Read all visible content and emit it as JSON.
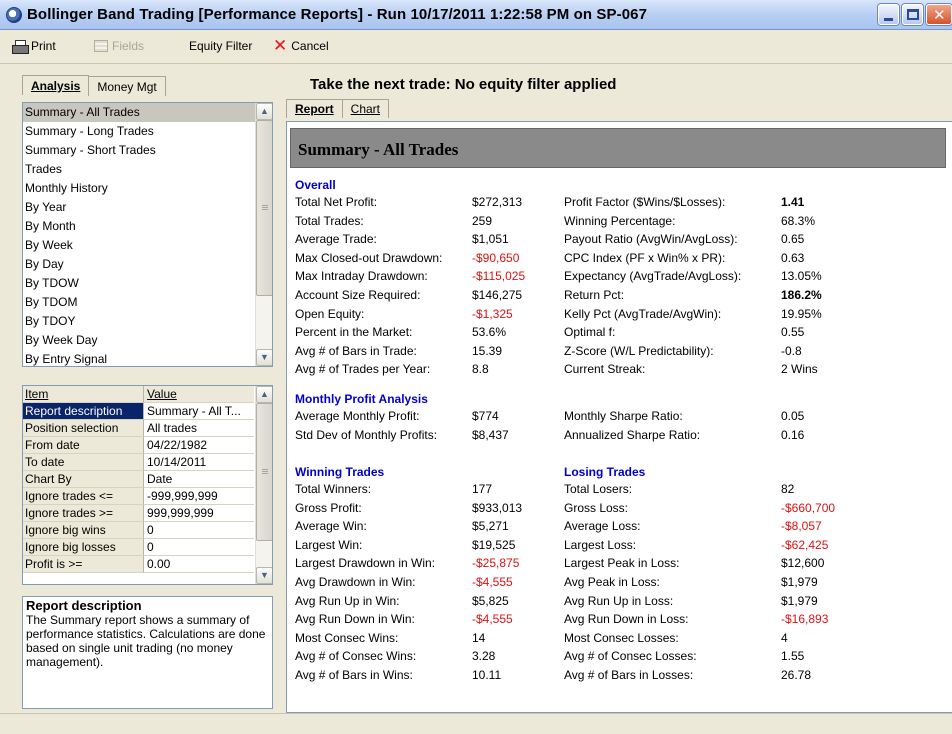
{
  "window": {
    "title": "Bollinger Band Trading  [Performance Reports]  -  Run 10/17/2011 1:22:58 PM on SP-067"
  },
  "toolbar": {
    "print": "Print",
    "fields": "Fields",
    "equity_filter": "Equity Filter",
    "cancel": "Cancel"
  },
  "left_tabs": [
    "Analysis",
    "Money Mgt"
  ],
  "report_list": [
    "Summary - All Trades",
    "Summary - Long Trades",
    "Summary - Short Trades",
    "Trades",
    "Monthly History",
    "By Year",
    "By Month",
    "By Week",
    "By Day",
    "By TDOW",
    "By TDOM",
    "By TDOY",
    "By Week Day",
    "By Entry Signal"
  ],
  "properties": {
    "header": {
      "item": "Item",
      "value": "Value"
    },
    "rows": [
      {
        "item": "Report description",
        "value": "Summary - All T..."
      },
      {
        "item": "Position selection",
        "value": "All trades"
      },
      {
        "item": "From date",
        "value": "04/22/1982"
      },
      {
        "item": "To date",
        "value": "10/14/2011"
      },
      {
        "item": "Chart By",
        "value": "Date"
      },
      {
        "item": "Ignore trades <=",
        "value": "-999,999,999"
      },
      {
        "item": "Ignore trades >=",
        "value": "999,999,999"
      },
      {
        "item": "Ignore big wins",
        "value": "0"
      },
      {
        "item": "Ignore big losses",
        "value": "0"
      },
      {
        "item": "Profit is >=",
        "value": "0.00"
      }
    ]
  },
  "description": {
    "title": "Report description",
    "text": "The Summary report shows a summary of performance statistics.  Calculations are done based on single unit trading (no money management)."
  },
  "headline": "Take the next trade: No equity filter applied",
  "right_tabs": [
    "Report",
    "Chart"
  ],
  "report": {
    "title": "Summary - All Trades",
    "overall_heading": "Overall",
    "overall_left": [
      {
        "label": "Total Net Profit:",
        "value": "$272,313",
        "style": ""
      },
      {
        "label": "Total Trades:",
        "value": "259",
        "style": ""
      },
      {
        "label": "Average Trade:",
        "value": "$1,051",
        "style": ""
      },
      {
        "label": "Max Closed-out Drawdown:",
        "value": "-$90,650",
        "style": "neg"
      },
      {
        "label": "Max Intraday Drawdown:",
        "value": "-$115,025",
        "style": "neg"
      },
      {
        "label": "Account Size Required:",
        "value": "$146,275",
        "style": ""
      },
      {
        "label": "Open Equity:",
        "value": "-$1,325",
        "style": "neg"
      },
      {
        "label": "Percent in the Market:",
        "value": "53.6%",
        "style": ""
      },
      {
        "label": "Avg # of Bars in Trade:",
        "value": "15.39",
        "style": ""
      },
      {
        "label": "Avg # of Trades per Year:",
        "value": "8.8",
        "style": ""
      }
    ],
    "overall_right": [
      {
        "label": "Profit Factor ($Wins/$Losses):",
        "value": "1.41",
        "style": "bold"
      },
      {
        "label": "Winning Percentage:",
        "value": "68.3%",
        "style": ""
      },
      {
        "label": "Payout Ratio (AvgWin/AvgLoss):",
        "value": "0.65",
        "style": ""
      },
      {
        "label": "CPC Index (PF x Win% x PR):",
        "value": "0.63",
        "style": ""
      },
      {
        "label": "Expectancy (AvgTrade/AvgLoss):",
        "value": "13.05%",
        "style": ""
      },
      {
        "label": "Return Pct:",
        "value": "186.2%",
        "style": "bold"
      },
      {
        "label": "Kelly Pct (AvgTrade/AvgWin):",
        "value": "19.95%",
        "style": ""
      },
      {
        "label": "Optimal f:",
        "value": "0.55",
        "style": ""
      },
      {
        "label": "Z-Score (W/L Predictability):",
        "value": "-0.8",
        "style": ""
      },
      {
        "label": "Current Streak:",
        "value": "2 Wins",
        "style": ""
      }
    ],
    "monthly_heading": "Monthly Profit Analysis",
    "monthly_left": [
      {
        "label": "Average Monthly Profit:",
        "value": "$774",
        "style": ""
      },
      {
        "label": "Std Dev of Monthly Profits:",
        "value": "$8,437",
        "style": ""
      }
    ],
    "monthly_right": [
      {
        "label": "Monthly Sharpe Ratio:",
        "value": "0.05",
        "style": ""
      },
      {
        "label": "Annualized Sharpe Ratio:",
        "value": "0.16",
        "style": ""
      }
    ],
    "winning_heading": "Winning Trades",
    "losing_heading": "Losing Trades",
    "winning": [
      {
        "label": "Total Winners:",
        "value": "177",
        "style": ""
      },
      {
        "label": "Gross Profit:",
        "value": "$933,013",
        "style": ""
      },
      {
        "label": "Average Win:",
        "value": "$5,271",
        "style": ""
      },
      {
        "label": "Largest Win:",
        "value": "$19,525",
        "style": ""
      },
      {
        "label": "Largest Drawdown in Win:",
        "value": "-$25,875",
        "style": "neg"
      },
      {
        "label": "Avg Drawdown in Win:",
        "value": "-$4,555",
        "style": "neg"
      },
      {
        "label": "Avg Run Up in Win:",
        "value": "$5,825",
        "style": ""
      },
      {
        "label": "Avg Run Down in Win:",
        "value": "-$4,555",
        "style": "neg"
      },
      {
        "label": "Most Consec Wins:",
        "value": "14",
        "style": ""
      },
      {
        "label": "Avg # of Consec Wins:",
        "value": "3.28",
        "style": ""
      },
      {
        "label": "Avg # of Bars in Wins:",
        "value": "10.11",
        "style": ""
      }
    ],
    "losing": [
      {
        "label": "Total Losers:",
        "value": "82",
        "style": ""
      },
      {
        "label": "Gross Loss:",
        "value": "-$660,700",
        "style": "neg"
      },
      {
        "label": "Average Loss:",
        "value": "-$8,057",
        "style": "neg"
      },
      {
        "label": "Largest Loss:",
        "value": "-$62,425",
        "style": "neg"
      },
      {
        "label": "Largest Peak in Loss:",
        "value": "$12,600",
        "style": ""
      },
      {
        "label": "Avg Peak in Loss:",
        "value": "$1,979",
        "style": ""
      },
      {
        "label": "Avg Run Up in Loss:",
        "value": "$1,979",
        "style": ""
      },
      {
        "label": "Avg Run Down in Loss:",
        "value": "-$16,893",
        "style": "neg"
      },
      {
        "label": "Most Consec Losses:",
        "value": "4",
        "style": ""
      },
      {
        "label": "Avg # of Consec Losses:",
        "value": "1.55",
        "style": ""
      },
      {
        "label": "Avg # of Bars in Losses:",
        "value": "26.78",
        "style": ""
      }
    ]
  }
}
